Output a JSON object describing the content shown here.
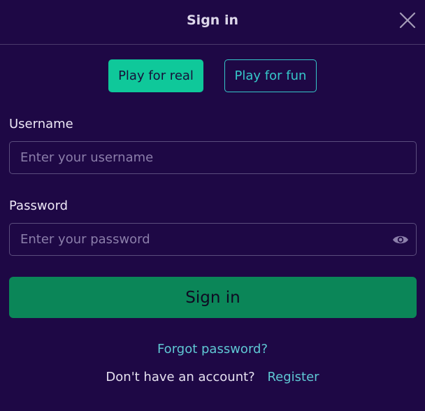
{
  "header": {
    "title": "Sign in",
    "close_icon": "close-icon"
  },
  "mode_toggle": {
    "real_label": "Play for real",
    "fun_label": "Play for fun",
    "active": "real"
  },
  "form": {
    "username": {
      "label": "Username",
      "placeholder": "Enter your username",
      "value": ""
    },
    "password": {
      "label": "Password",
      "placeholder": "Enter your password",
      "value": "",
      "toggle_icon": "eye-icon"
    },
    "submit_label": "Sign in"
  },
  "footer": {
    "forgot_label": "Forgot password?",
    "register_prompt": "Don't have an account?",
    "register_label": "Register"
  },
  "colors": {
    "background": "#1e0845",
    "accent_primary": "#0fc89a",
    "accent_secondary": "#36c7c9",
    "submit": "#0b8658",
    "link": "#5fc8d4"
  }
}
